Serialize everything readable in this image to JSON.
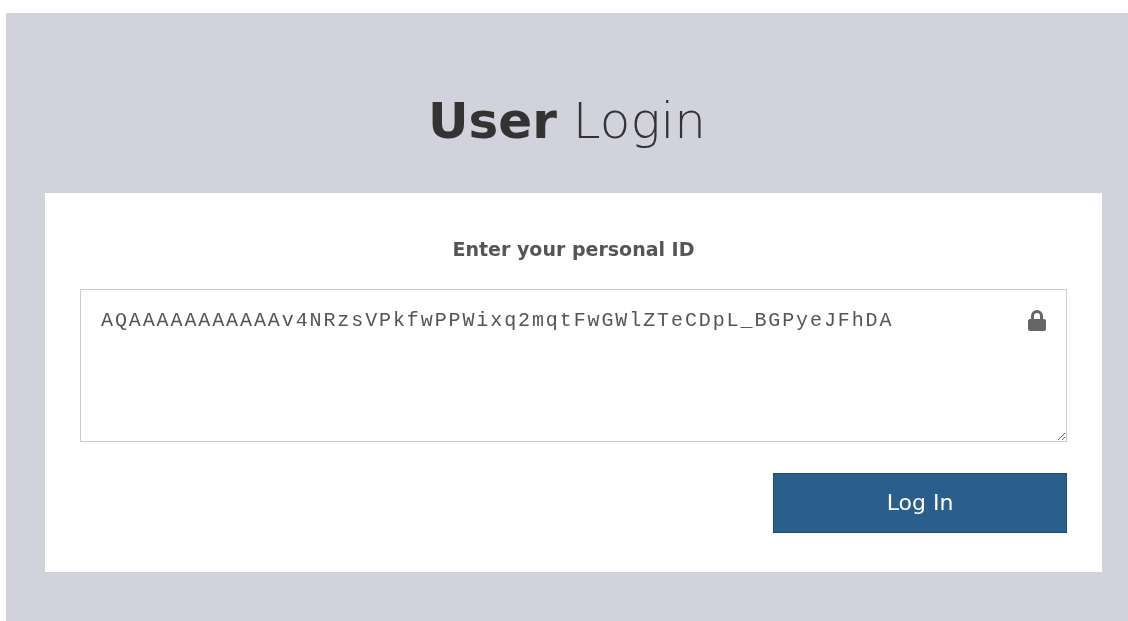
{
  "title": "**User** Login",
  "form": {
    "label": "Enter your personal ID",
    "id_field": {
      "value": "AQAAAAAAAAAAAv4NRzsVPkfwPPWixq2mqtFwGWlZTeCDpL_BGPyeJFhDA"
    },
    "button": "Log In"
  }
}
